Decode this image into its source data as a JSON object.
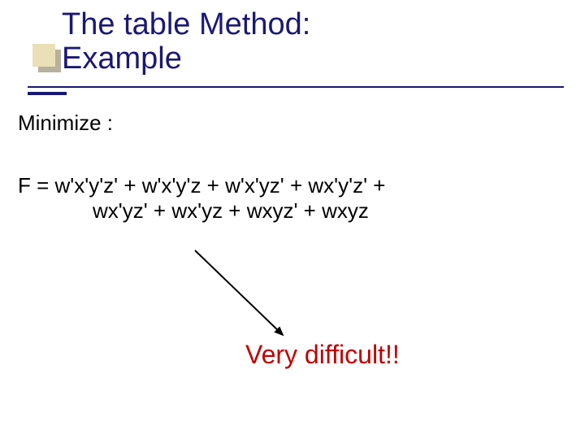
{
  "title": {
    "line1": "The table Method:",
    "line2": "Example"
  },
  "body": {
    "minimize_label": "Minimize :",
    "formula_line1": "F = w'x'y'z' + w'x'y'z + w'x'yz' + wx'y'z' +",
    "formula_line2": "wx'yz' + wx'yz + wxyz' + wxyz"
  },
  "callout": {
    "text": "Very difficult!!"
  },
  "colors": {
    "title_color": "#1a1875",
    "accent_fill": "#eadfb6",
    "accent_shadow": "#b7b19d",
    "callout_color": "#c00000"
  }
}
